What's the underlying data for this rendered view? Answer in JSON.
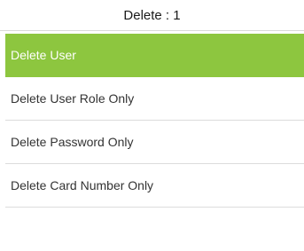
{
  "header": {
    "title": "Delete : 1"
  },
  "menu": {
    "items": [
      {
        "label": "Delete User",
        "selected": true
      },
      {
        "label": "Delete User Role Only",
        "selected": false
      },
      {
        "label": "Delete Password Only",
        "selected": false
      },
      {
        "label": "Delete Card Number Only",
        "selected": false
      }
    ]
  },
  "colors": {
    "selected_background": "#8dc63f",
    "selected_text": "#ffffff",
    "divider": "#dcdcdc",
    "text": "#333333"
  }
}
